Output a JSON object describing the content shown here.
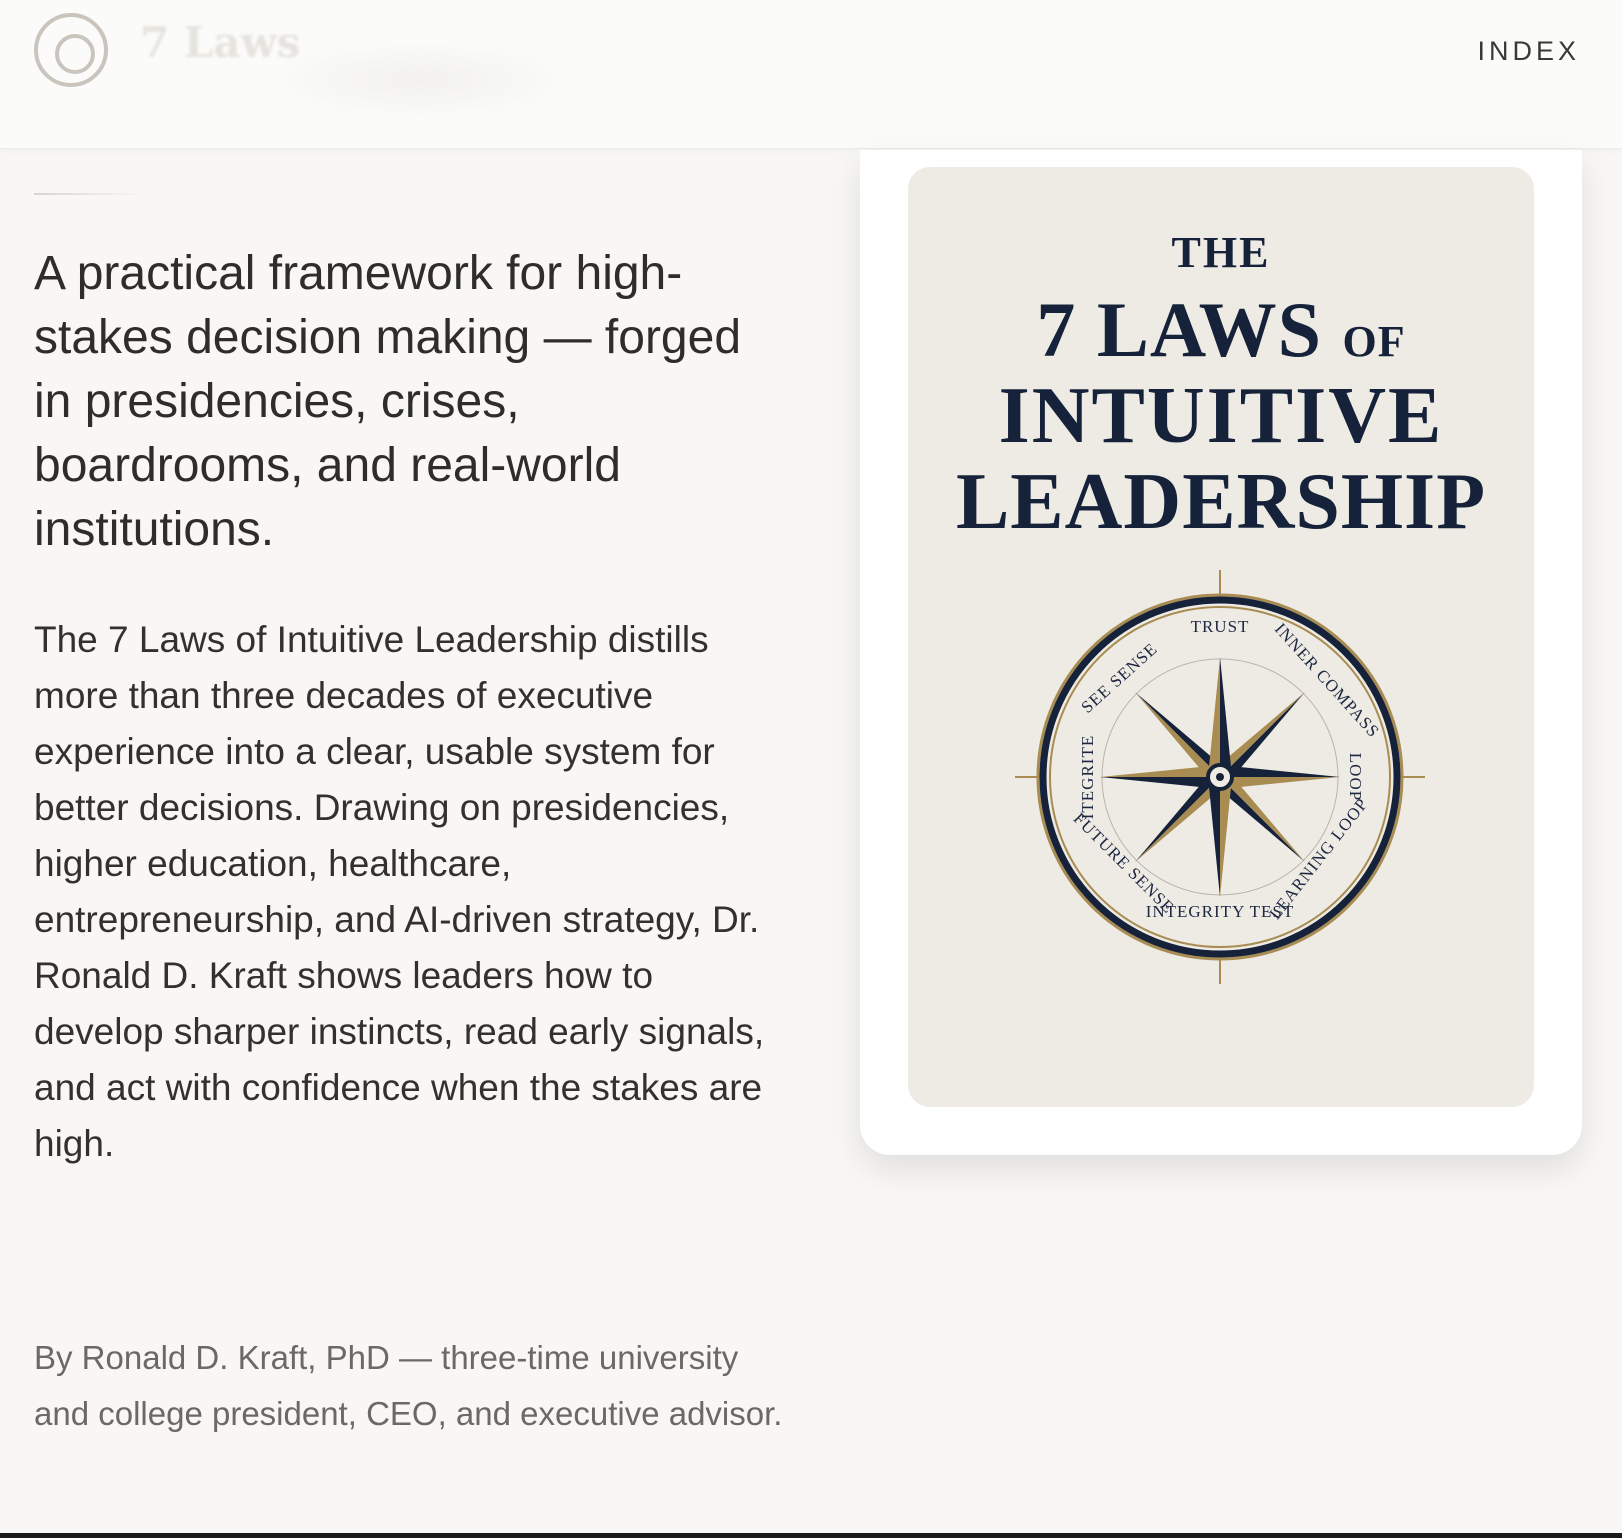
{
  "header": {
    "logo_text": "7 Laws",
    "nav_index": "INDEX"
  },
  "hero": {
    "lead": "A practical framework for high-stakes decision making — forged in presidencies, crises, boardrooms, and real-world institutions.",
    "description": "The 7 Laws of Intuitive Leadership distills more than three decades of executive experience into a clear, usable system for better decisions. Drawing on presidencies, higher education, healthcare, entrepreneurship, and AI-driven strategy, Dr. Ronald D. Kraft shows leaders how to develop sharper instincts, read early signals, and act with confidence when the stakes are high.",
    "byline": "By Ronald D. Kraft, PhD — three-time university and college president, CEO, and executive advisor."
  },
  "book_cover": {
    "title_the": "THE",
    "title_laws": "7 LAWS",
    "title_of": "OF",
    "title_intuitive": "INTUITIVE",
    "title_leadership": "LEADERSHIP",
    "compass_labels": {
      "trust": "TRUST",
      "see_sense": "SEE SENSE",
      "inner_compass": "INNER COMPASS",
      "loop": "LOOP",
      "learning_loop": "LEARNING LOOP",
      "integrity_test": "INTEGRITY TEST",
      "future_sense": "FUTURE SENSE",
      "itegrite": "ITEGRITE"
    },
    "colors": {
      "navy": "#16223a",
      "gold": "#a88c52",
      "paper": "#eeebe4"
    }
  }
}
